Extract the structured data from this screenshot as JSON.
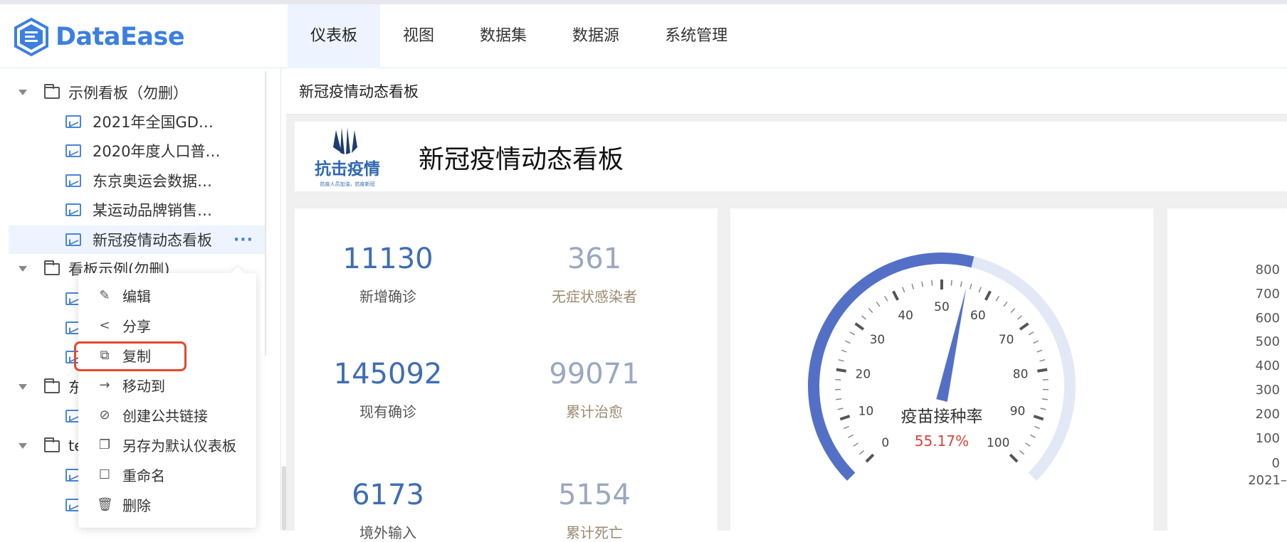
{
  "app": {
    "brand": "DataEase"
  },
  "nav": {
    "items": [
      "仪表板",
      "视图",
      "数据集",
      "数据源",
      "系统管理"
    ],
    "active": 0
  },
  "sidebar": {
    "folder1": "示例看板（勿删）",
    "items1": [
      "2021年全国GD…",
      "2020年度人口普…",
      "东京奥运会数据…",
      "某运动品牌销售…",
      "新冠疫情动态看板"
    ],
    "folder2": "看板示例(勿删)",
    "folder3": "东",
    "folder4": "te",
    "more": "···"
  },
  "menu": {
    "items": [
      {
        "label": "编辑",
        "icon": "edit-icon"
      },
      {
        "label": "分享",
        "icon": "share-icon"
      },
      {
        "label": "复制",
        "icon": "copy-icon"
      },
      {
        "label": "移动到",
        "icon": "arrow-right-icon"
      },
      {
        "label": "创建公共链接",
        "icon": "link-icon"
      },
      {
        "label": "另存为默认仪表板",
        "icon": "save-template-icon"
      },
      {
        "label": "重命名",
        "icon": "rename-icon"
      },
      {
        "label": "删除",
        "icon": "trash-icon"
      }
    ]
  },
  "content": {
    "breadcrumb": "新冠疫情动态看板",
    "dashboard_title": "新冠疫情动态看板",
    "logo_text": "抗击疫情",
    "logo_sub": "抗疫人员加油，抗疫新冠",
    "stats": [
      {
        "value": "11130",
        "label": "新增确诊"
      },
      {
        "value": "361",
        "label": "无症状感染者"
      },
      {
        "value": "145092",
        "label": "现有确诊"
      },
      {
        "value": "99071",
        "label": "累计治愈"
      },
      {
        "value": "6173",
        "label": "境外输入"
      },
      {
        "value": "5154",
        "label": "累计死亡"
      }
    ],
    "gauge": {
      "title": "疫苗接种率",
      "value_text": "55.17%",
      "value": 55.17,
      "min": 0,
      "max": 100,
      "ticks": [
        0,
        10,
        20,
        30,
        40,
        50,
        60,
        70,
        80,
        90,
        100
      ],
      "colors": {
        "fill": "#5470c6",
        "track": "#e3e8f6",
        "value": "#e0413a"
      }
    },
    "axis": {
      "ticks": [
        "800",
        "700",
        "600",
        "500",
        "400",
        "300",
        "200",
        "100",
        "0"
      ],
      "x_label": "2021–"
    }
  }
}
